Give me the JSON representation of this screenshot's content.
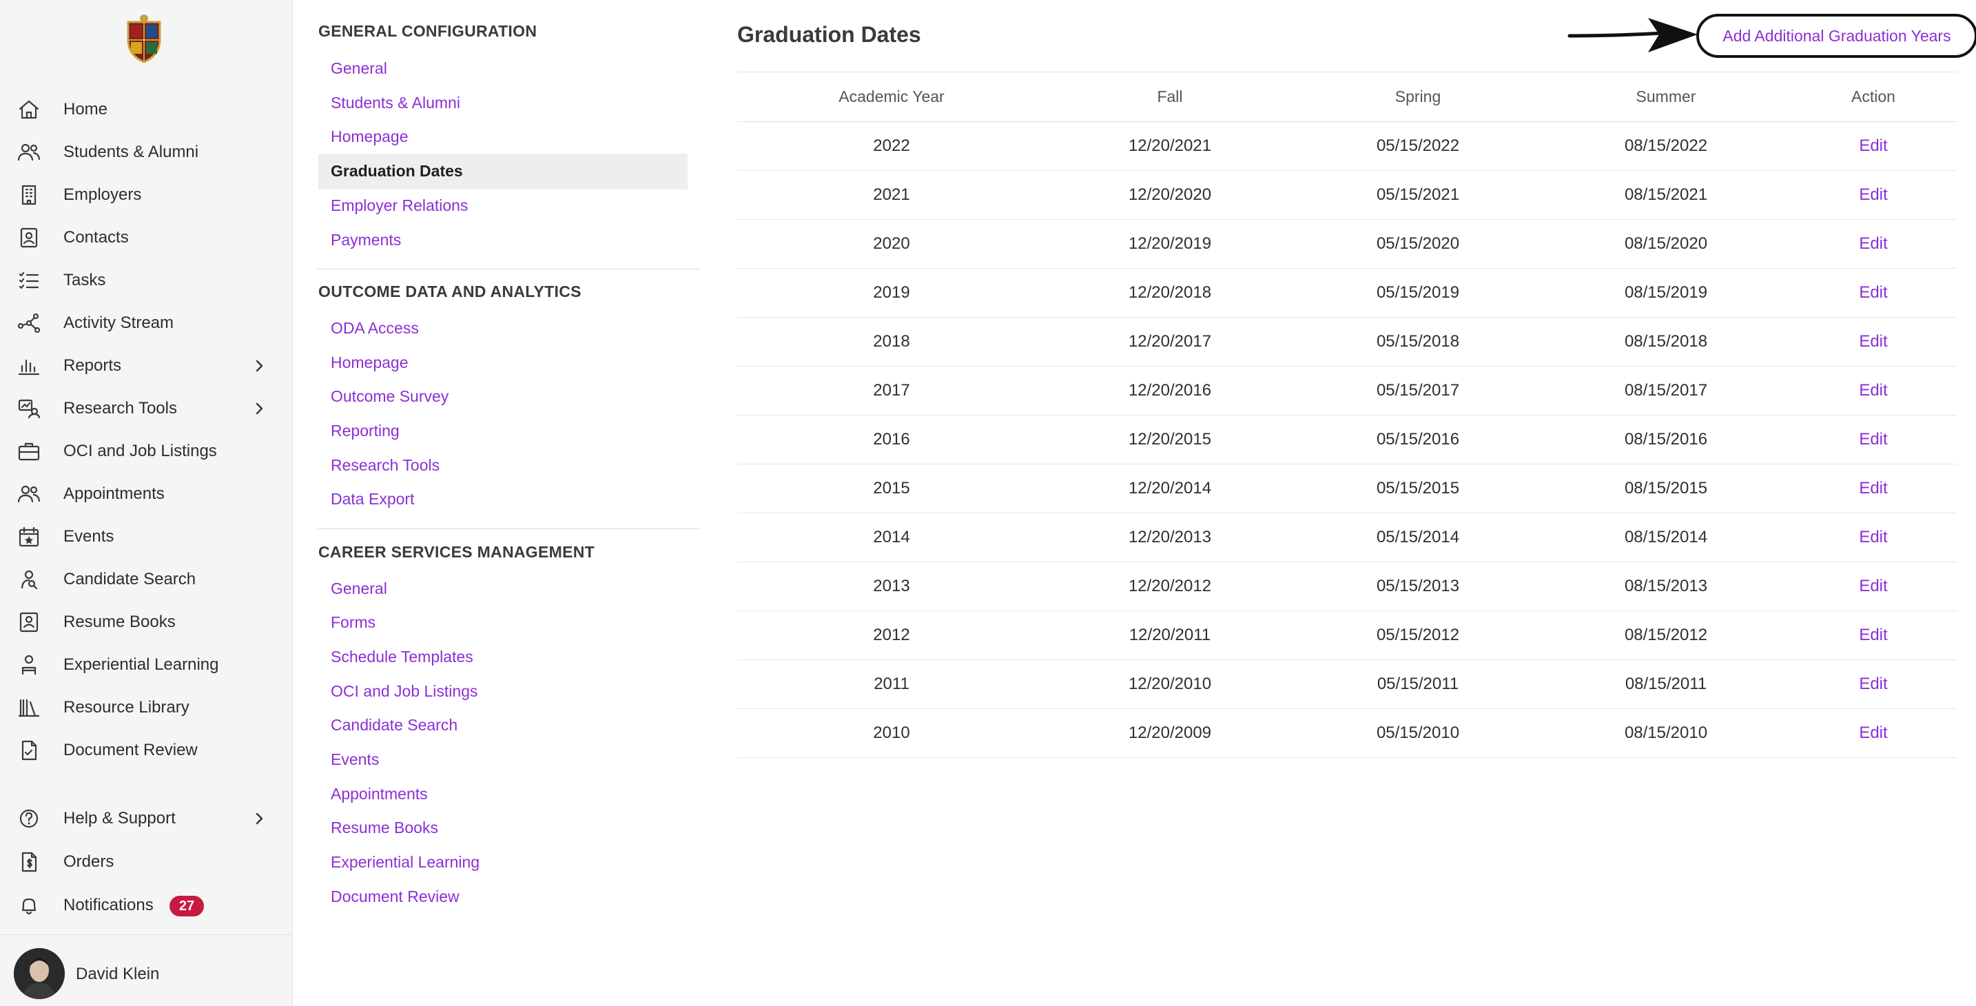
{
  "sidebar": {
    "items": [
      {
        "label": "Home",
        "icon": "home-icon"
      },
      {
        "label": "Students & Alumni",
        "icon": "people-icon"
      },
      {
        "label": "Employers",
        "icon": "building-icon"
      },
      {
        "label": "Contacts",
        "icon": "contact-card-icon"
      },
      {
        "label": "Tasks",
        "icon": "checklist-icon"
      },
      {
        "label": "Activity Stream",
        "icon": "network-icon"
      },
      {
        "label": "Reports",
        "icon": "bar-chart-icon",
        "expandable": true
      },
      {
        "label": "Research Tools",
        "icon": "research-icon",
        "expandable": true
      },
      {
        "label": "OCI and Job Listings",
        "icon": "briefcase-icon"
      },
      {
        "label": "Appointments",
        "icon": "people-icon"
      },
      {
        "label": "Events",
        "icon": "calendar-star-icon"
      },
      {
        "label": "Candidate Search",
        "icon": "search-person-icon"
      },
      {
        "label": "Resume Books",
        "icon": "book-person-icon"
      },
      {
        "label": "Experiential Learning",
        "icon": "person-badge-icon"
      },
      {
        "label": "Resource Library",
        "icon": "library-icon"
      },
      {
        "label": "Document Review",
        "icon": "document-check-icon"
      }
    ],
    "bottom_items": [
      {
        "label": "Help & Support",
        "icon": "help-circle-icon",
        "expandable": true
      },
      {
        "label": "Orders",
        "icon": "receipt-icon"
      },
      {
        "label": "Notifications",
        "icon": "bell-icon",
        "badge": "27"
      }
    ],
    "user": {
      "name": "David Klein"
    }
  },
  "settings_nav": {
    "general_configuration": {
      "heading": "GENERAL CONFIGURATION",
      "links": [
        "General",
        "Students & Alumni",
        "Homepage",
        "Graduation Dates",
        "Employer Relations",
        "Payments"
      ],
      "active": "Graduation Dates"
    },
    "outcome_data": {
      "heading": "OUTCOME DATA AND ANALYTICS",
      "links": [
        "ODA Access",
        "Homepage",
        "Outcome Survey",
        "Reporting",
        "Research Tools",
        "Data Export"
      ]
    },
    "career_services": {
      "heading": "CAREER SERVICES MANAGEMENT",
      "links": [
        "General",
        "Forms",
        "Schedule Templates",
        "OCI and Job Listings",
        "Candidate Search",
        "Events",
        "Appointments",
        "Resume Books",
        "Experiential Learning",
        "Document Review"
      ]
    }
  },
  "main": {
    "title": "Graduation Dates",
    "add_button": "Add Additional Graduation Years",
    "table": {
      "headers": [
        "Academic Year",
        "Fall",
        "Spring",
        "Summer",
        "Action"
      ],
      "rows": [
        [
          "2022",
          "12/20/2021",
          "05/15/2022",
          "08/15/2022",
          "Edit"
        ],
        [
          "2021",
          "12/20/2020",
          "05/15/2021",
          "08/15/2021",
          "Edit"
        ],
        [
          "2020",
          "12/20/2019",
          "05/15/2020",
          "08/15/2020",
          "Edit"
        ],
        [
          "2019",
          "12/20/2018",
          "05/15/2019",
          "08/15/2019",
          "Edit"
        ],
        [
          "2018",
          "12/20/2017",
          "05/15/2018",
          "08/15/2018",
          "Edit"
        ],
        [
          "2017",
          "12/20/2016",
          "05/15/2017",
          "08/15/2017",
          "Edit"
        ],
        [
          "2016",
          "12/20/2015",
          "05/15/2016",
          "08/15/2016",
          "Edit"
        ],
        [
          "2015",
          "12/20/2014",
          "05/15/2015",
          "08/15/2015",
          "Edit"
        ],
        [
          "2014",
          "12/20/2013",
          "05/15/2014",
          "08/15/2014",
          "Edit"
        ],
        [
          "2013",
          "12/20/2012",
          "05/15/2013",
          "08/15/2013",
          "Edit"
        ],
        [
          "2012",
          "12/20/2011",
          "05/15/2012",
          "08/15/2012",
          "Edit"
        ],
        [
          "2011",
          "12/20/2010",
          "05/15/2011",
          "08/15/2011",
          "Edit"
        ],
        [
          "2010",
          "12/20/2009",
          "05/15/2010",
          "08/15/2010",
          "Edit"
        ]
      ]
    }
  },
  "colors": {
    "accent": "#8b2fd6",
    "badge": "#c8193e",
    "sidebar_bg": "#f5f5f5"
  }
}
